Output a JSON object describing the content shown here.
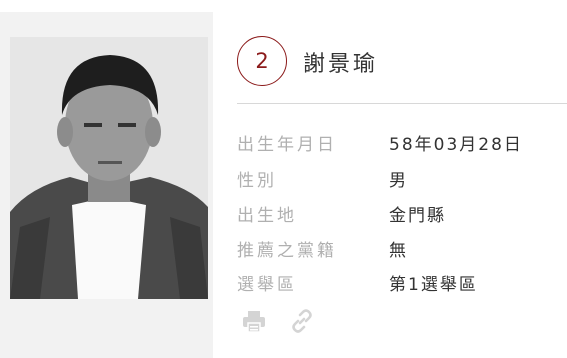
{
  "candidate": {
    "number": "2",
    "name": "謝景瑜",
    "photo_alt": "候選人照片"
  },
  "details": [
    {
      "label": "出生年月日",
      "value": "58年03月28日"
    },
    {
      "label": "性別",
      "value": "男"
    },
    {
      "label": "出生地",
      "value": "金門縣"
    },
    {
      "label": "推薦之黨籍",
      "value": "無"
    },
    {
      "label": "選舉區",
      "value": "第1選舉區"
    }
  ],
  "actions": [
    {
      "icon": "print-icon"
    },
    {
      "icon": "link-icon"
    }
  ],
  "colors": {
    "accent": "#8b1a1a",
    "label": "#b0b0b0",
    "panel": "#f2f2f2"
  }
}
